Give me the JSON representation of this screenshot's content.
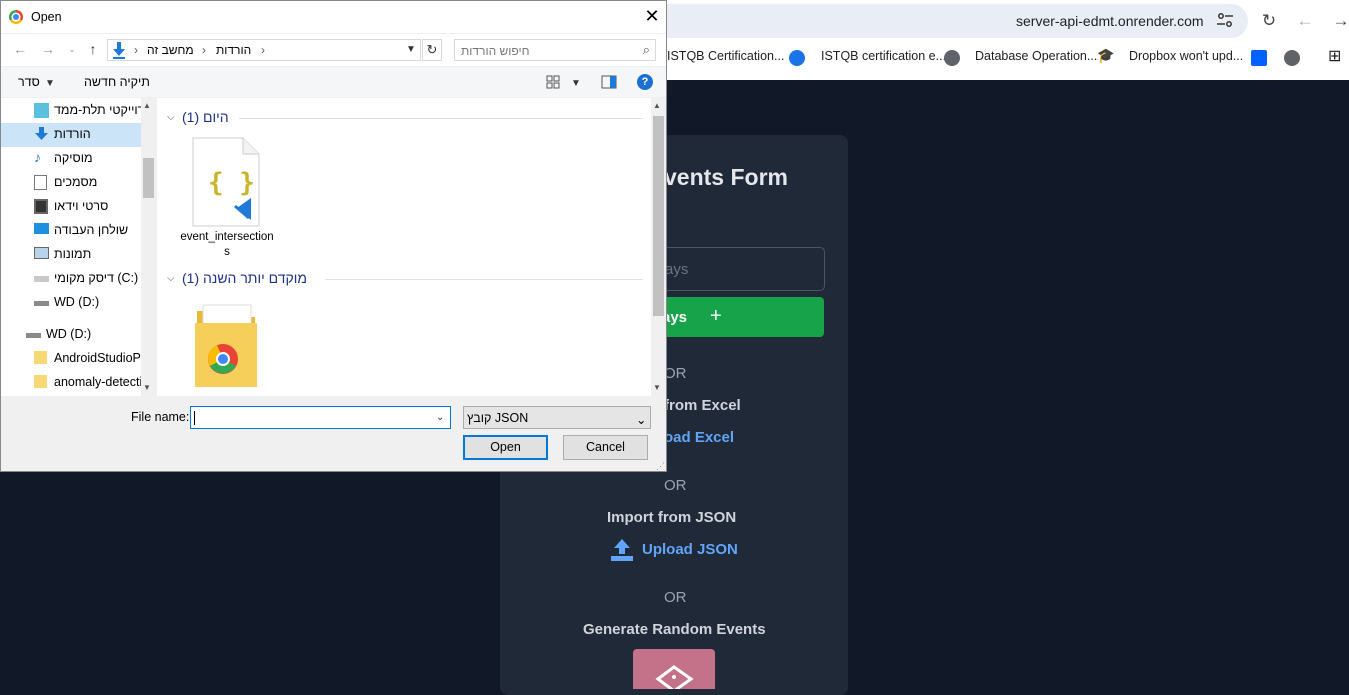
{
  "browser": {
    "url": "server-api-edmt.onrender.com",
    "bookmarks": [
      {
        "label": "ISTQB Certification...",
        "icon": "bookmark-icon"
      },
      {
        "label": "ISTQB certification e...",
        "icon": "globe-icon"
      },
      {
        "label": "Database Operation...",
        "icon": "graduation-cap-icon"
      },
      {
        "label": "Dropbox won't upd...",
        "icon": "dropbox-icon"
      }
    ]
  },
  "page": {
    "title": "vents Form",
    "input_placeholder": "ays",
    "add_button_label": "ays",
    "or_label": "OR",
    "excel_heading": "from Excel",
    "excel_link": "oad Excel",
    "json_heading": "Import from JSON",
    "json_link": "Upload JSON",
    "random_heading": "Generate Random Events"
  },
  "dialog": {
    "title": "Open",
    "breadcrumb": [
      "מחשב זה",
      "הורדות"
    ],
    "search_placeholder": "חיפוש הורדות",
    "organize_label": "סדר",
    "new_folder_label": "תיקיה חדשה",
    "nav_items": [
      {
        "label": "פרוייקטי תלת-ממד",
        "icon": "3d-objects-icon",
        "selected": false
      },
      {
        "label": "הורדות",
        "icon": "downloads-icon",
        "selected": true
      },
      {
        "label": "מוסיקה",
        "icon": "music-icon",
        "selected": false
      },
      {
        "label": "מסמכים",
        "icon": "documents-icon",
        "selected": false
      },
      {
        "label": "סרטי וידאו",
        "icon": "videos-icon",
        "selected": false
      },
      {
        "label": "שולחן העבודה",
        "icon": "desktop-icon",
        "selected": false
      },
      {
        "label": "תמונות",
        "icon": "pictures-icon",
        "selected": false
      },
      {
        "label": "דיסק מקומי (C:)",
        "icon": "drive-icon",
        "selected": false
      },
      {
        "label": "WD (D:)",
        "icon": "drive-icon",
        "selected": false
      },
      {
        "label": "WD (D:)",
        "icon": "drive-icon",
        "selected": false
      },
      {
        "label": "AndroidStudioPr",
        "icon": "folder-icon",
        "selected": false
      },
      {
        "label": "anomaly-detecti",
        "icon": "folder-icon",
        "selected": false
      }
    ],
    "groups": [
      {
        "label": "היום (1)",
        "file": "event_intersections"
      },
      {
        "label": "מוקדם יותר השנה (1)",
        "file": ""
      }
    ],
    "filename_label": "File name:",
    "filename_value": "",
    "filetype_label": "קובץ JSON",
    "open_button": "Open",
    "cancel_button": "Cancel"
  }
}
